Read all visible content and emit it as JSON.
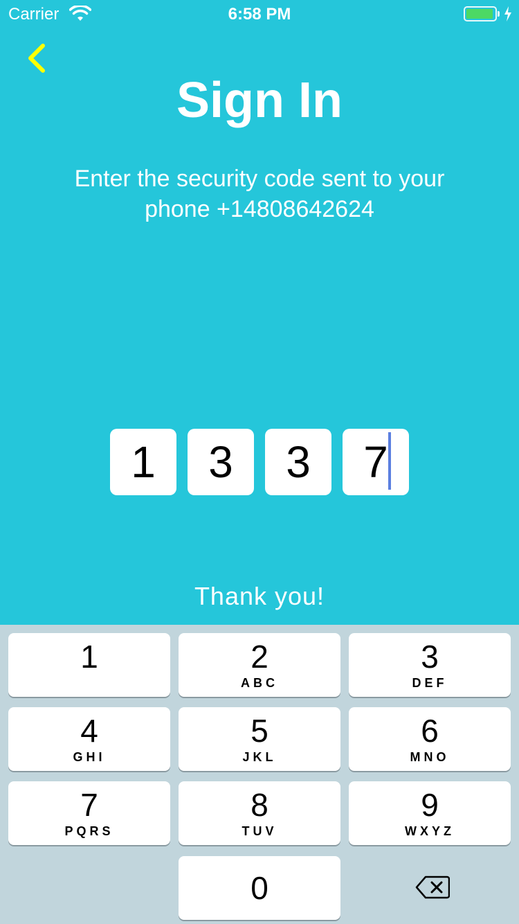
{
  "status_bar": {
    "carrier": "Carrier",
    "time": "6:58 PM",
    "battery_level": 0.95,
    "battery_color": "#4cd964"
  },
  "header": {
    "back_icon": "chevron-left-icon",
    "back_color": "#ffff00",
    "title": "Sign In",
    "subtitle": "Enter the security code sent to your phone +14808642624"
  },
  "code": {
    "digits": [
      "1",
      "3",
      "3",
      "7"
    ],
    "focused_index": 3
  },
  "message": "Thank you!",
  "keypad": {
    "keys": [
      {
        "digit": "1",
        "letters": ""
      },
      {
        "digit": "2",
        "letters": "ABC"
      },
      {
        "digit": "3",
        "letters": "DEF"
      },
      {
        "digit": "4",
        "letters": "GHI"
      },
      {
        "digit": "5",
        "letters": "JKL"
      },
      {
        "digit": "6",
        "letters": "MNO"
      },
      {
        "digit": "7",
        "letters": "PQRS"
      },
      {
        "digit": "8",
        "letters": "TUV"
      },
      {
        "digit": "9",
        "letters": "WXYZ"
      },
      {
        "digit": "0",
        "letters": ""
      }
    ],
    "delete_icon": "backspace-icon"
  },
  "colors": {
    "background": "#25C6DA",
    "keypad_background": "#C1D5DC",
    "caret": "#5b7fe0"
  }
}
